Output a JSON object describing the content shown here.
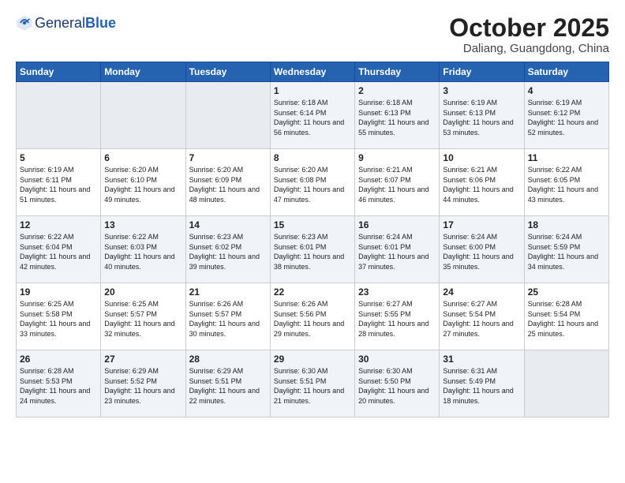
{
  "header": {
    "logo_general": "General",
    "logo_blue": "Blue",
    "month_title": "October 2025",
    "location": "Daliang, Guangdong, China"
  },
  "days_of_week": [
    "Sunday",
    "Monday",
    "Tuesday",
    "Wednesday",
    "Thursday",
    "Friday",
    "Saturday"
  ],
  "weeks": [
    [
      {
        "day": "",
        "empty": true
      },
      {
        "day": "",
        "empty": true
      },
      {
        "day": "",
        "empty": true
      },
      {
        "day": "1",
        "sunrise": "6:18 AM",
        "sunset": "6:14 PM",
        "daylight": "11 hours and 56 minutes."
      },
      {
        "day": "2",
        "sunrise": "6:18 AM",
        "sunset": "6:13 PM",
        "daylight": "11 hours and 55 minutes."
      },
      {
        "day": "3",
        "sunrise": "6:19 AM",
        "sunset": "6:13 PM",
        "daylight": "11 hours and 53 minutes."
      },
      {
        "day": "4",
        "sunrise": "6:19 AM",
        "sunset": "6:12 PM",
        "daylight": "11 hours and 52 minutes."
      }
    ],
    [
      {
        "day": "5",
        "sunrise": "6:19 AM",
        "sunset": "6:11 PM",
        "daylight": "11 hours and 51 minutes."
      },
      {
        "day": "6",
        "sunrise": "6:20 AM",
        "sunset": "6:10 PM",
        "daylight": "11 hours and 49 minutes."
      },
      {
        "day": "7",
        "sunrise": "6:20 AM",
        "sunset": "6:09 PM",
        "daylight": "11 hours and 48 minutes."
      },
      {
        "day": "8",
        "sunrise": "6:20 AM",
        "sunset": "6:08 PM",
        "daylight": "11 hours and 47 minutes."
      },
      {
        "day": "9",
        "sunrise": "6:21 AM",
        "sunset": "6:07 PM",
        "daylight": "11 hours and 46 minutes."
      },
      {
        "day": "10",
        "sunrise": "6:21 AM",
        "sunset": "6:06 PM",
        "daylight": "11 hours and 44 minutes."
      },
      {
        "day": "11",
        "sunrise": "6:22 AM",
        "sunset": "6:05 PM",
        "daylight": "11 hours and 43 minutes."
      }
    ],
    [
      {
        "day": "12",
        "sunrise": "6:22 AM",
        "sunset": "6:04 PM",
        "daylight": "11 hours and 42 minutes."
      },
      {
        "day": "13",
        "sunrise": "6:22 AM",
        "sunset": "6:03 PM",
        "daylight": "11 hours and 40 minutes."
      },
      {
        "day": "14",
        "sunrise": "6:23 AM",
        "sunset": "6:02 PM",
        "daylight": "11 hours and 39 minutes."
      },
      {
        "day": "15",
        "sunrise": "6:23 AM",
        "sunset": "6:01 PM",
        "daylight": "11 hours and 38 minutes."
      },
      {
        "day": "16",
        "sunrise": "6:24 AM",
        "sunset": "6:01 PM",
        "daylight": "11 hours and 37 minutes."
      },
      {
        "day": "17",
        "sunrise": "6:24 AM",
        "sunset": "6:00 PM",
        "daylight": "11 hours and 35 minutes."
      },
      {
        "day": "18",
        "sunrise": "6:24 AM",
        "sunset": "5:59 PM",
        "daylight": "11 hours and 34 minutes."
      }
    ],
    [
      {
        "day": "19",
        "sunrise": "6:25 AM",
        "sunset": "5:58 PM",
        "daylight": "11 hours and 33 minutes."
      },
      {
        "day": "20",
        "sunrise": "6:25 AM",
        "sunset": "5:57 PM",
        "daylight": "11 hours and 32 minutes."
      },
      {
        "day": "21",
        "sunrise": "6:26 AM",
        "sunset": "5:57 PM",
        "daylight": "11 hours and 30 minutes."
      },
      {
        "day": "22",
        "sunrise": "6:26 AM",
        "sunset": "5:56 PM",
        "daylight": "11 hours and 29 minutes."
      },
      {
        "day": "23",
        "sunrise": "6:27 AM",
        "sunset": "5:55 PM",
        "daylight": "11 hours and 28 minutes."
      },
      {
        "day": "24",
        "sunrise": "6:27 AM",
        "sunset": "5:54 PM",
        "daylight": "11 hours and 27 minutes."
      },
      {
        "day": "25",
        "sunrise": "6:28 AM",
        "sunset": "5:54 PM",
        "daylight": "11 hours and 25 minutes."
      }
    ],
    [
      {
        "day": "26",
        "sunrise": "6:28 AM",
        "sunset": "5:53 PM",
        "daylight": "11 hours and 24 minutes."
      },
      {
        "day": "27",
        "sunrise": "6:29 AM",
        "sunset": "5:52 PM",
        "daylight": "11 hours and 23 minutes."
      },
      {
        "day": "28",
        "sunrise": "6:29 AM",
        "sunset": "5:51 PM",
        "daylight": "11 hours and 22 minutes."
      },
      {
        "day": "29",
        "sunrise": "6:30 AM",
        "sunset": "5:51 PM",
        "daylight": "11 hours and 21 minutes."
      },
      {
        "day": "30",
        "sunrise": "6:30 AM",
        "sunset": "5:50 PM",
        "daylight": "11 hours and 20 minutes."
      },
      {
        "day": "31",
        "sunrise": "6:31 AM",
        "sunset": "5:49 PM",
        "daylight": "11 hours and 18 minutes."
      },
      {
        "day": "",
        "empty": true
      }
    ]
  ],
  "labels": {
    "sunrise": "Sunrise:",
    "sunset": "Sunset:",
    "daylight": "Daylight:"
  }
}
